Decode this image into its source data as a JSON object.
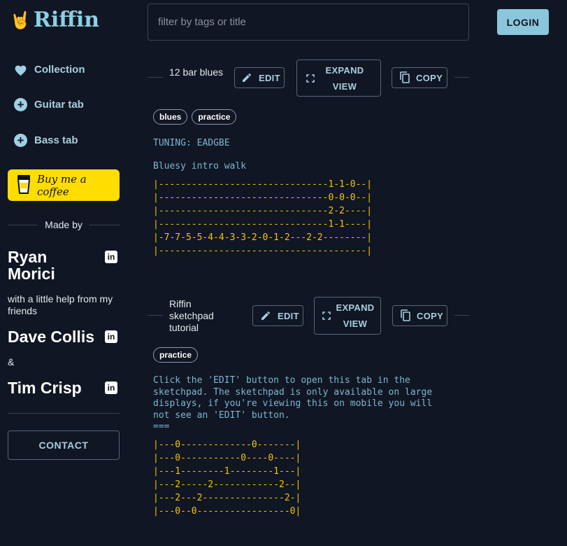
{
  "brand": {
    "name": "Riffin",
    "logo_icon": "rock-hand-icon"
  },
  "search": {
    "placeholder": "filter by tags or title",
    "value": ""
  },
  "header": {
    "login_label": "LOGIN"
  },
  "sidebar": {
    "items": [
      {
        "label": "Collection",
        "icon": "heart-icon"
      },
      {
        "label": "Guitar tab",
        "icon": "plus-circle-icon"
      },
      {
        "label": "Bass tab",
        "icon": "plus-circle-icon"
      }
    ],
    "coffee_label": "Buy me a coffee",
    "made_by": "Made by",
    "author1": "Ryan Morici",
    "help_text": "with a little help from my friends",
    "author2": "Dave Collis",
    "ampersand": "&",
    "author3": "Tim Crisp",
    "contact_label": "CONTACT"
  },
  "tabs": [
    {
      "title": "12 bar blues",
      "edit_label": "EDIT",
      "expand_label": "EXPAND VIEW",
      "copy_label": "COPY",
      "tags": [
        "blues",
        "practice"
      ],
      "tuning": "TUNING: EADGBE",
      "description": "Bluesy intro walk",
      "tab_text": "|-------------------------------1-1-0--|\n|-------------------------------0-0-0--|\n|-------------------------------2-2----|\n|-------------------------------1-1----|\n|-7-7-5-5-4-4-3-3-2-0-1-2---2-2--------|\n|--------------------------------------|"
    },
    {
      "title": "Riffin sketchpad tutorial",
      "edit_label": "EDIT",
      "expand_label": "EXPAND VIEW",
      "copy_label": "COPY",
      "tags": [
        "practice"
      ],
      "description": "Click the 'EDIT' button to open this tab in the\nsketchpad. The sketchpad is only available on large\ndisplays, if you're viewing this on mobile you will\nnot see an 'EDIT' button.\n===",
      "tab_text": "|---0-------------0-------|\n|---0-----------0----0----|\n|---1--------1--------1---|\n|---2-----2------------2--|\n|---2---2---------------2-|\n|---0--0-----------------0|"
    }
  ]
}
